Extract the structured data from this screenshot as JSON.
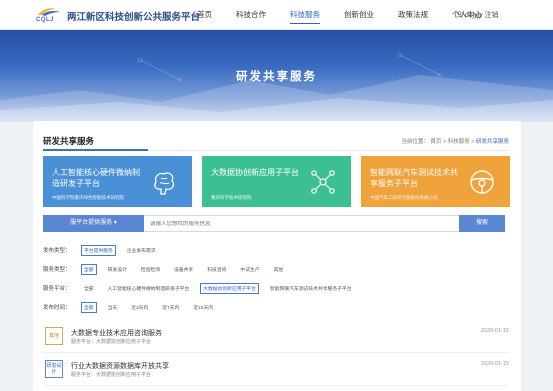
{
  "header": {
    "logo_text": "CQLJ",
    "site_title": "两江新区科技创新公共服务平台",
    "nav": [
      "首页",
      "科技合作",
      "科技服务",
      "创新创业",
      "政策法规",
      "个人中心"
    ],
    "active_nav": "科技服务",
    "user_name": "dsjyjy",
    "logout": "注销"
  },
  "banner": {
    "title": "研发共享服务"
  },
  "panel": {
    "title": "研发共享服务",
    "breadcrumb": {
      "prefix": "当前位置：",
      "items": [
        "首页",
        "科技服务"
      ],
      "current": "研发共享服务"
    }
  },
  "cards": [
    {
      "title": "人工智能核心硬件微纳制造研发子平台",
      "sub": "中国科学院重庆绿色智能技术研究院",
      "color": "#4a90d6",
      "icon": "brain-icon"
    },
    {
      "title": "大数据协创新应用子平台",
      "sub": "重庆科学技术研究院",
      "color": "#3cc092",
      "icon": "network-icon"
    },
    {
      "title": "智能网联汽车测试技术共享服务子平台",
      "sub": "中国汽车工程研究院股份有限公司",
      "color": "#f0a23b",
      "icon": "steering-wheel-icon"
    }
  ],
  "search": {
    "select_label": "服平台提供服务 ▾",
    "placeholder": "请输入您想找的服务信息",
    "button": "搜索"
  },
  "filters": [
    {
      "label": "发布类型：",
      "options": [
        "平台提供服务",
        "企业发布需求"
      ],
      "selected": 0
    },
    {
      "label": "服务类型：",
      "options": [
        "全部",
        "研发设计",
        "检验检测",
        "设备共享",
        "科技咨询",
        "中试生产",
        "其他"
      ],
      "selected": 0
    },
    {
      "label": "服务平台：",
      "options": [
        "全部",
        "人工智能核心硬件微纳制造研发子平台",
        "大数据协创新应用子平台",
        "智能网联汽车测试技术共享服务子平台"
      ],
      "selected": 2
    },
    {
      "label": "发布时间：",
      "options": [
        "全部",
        "当天",
        "近3天内",
        "近7天内",
        "近15天内"
      ],
      "selected": 0
    }
  ],
  "results": [
    {
      "tag": "其他",
      "tag_style": "orange",
      "title": "大数据专业技术应用咨询服务",
      "meta": "服务平台：大数据协创新应用子平台",
      "date": "2020-01-15"
    },
    {
      "tag": "研发设计",
      "tag_style": "blue",
      "title": "行业大数据资源数据库开放共享",
      "meta": "服务平台：大数据协创新应用子平台",
      "date": "2020-01-15"
    }
  ]
}
